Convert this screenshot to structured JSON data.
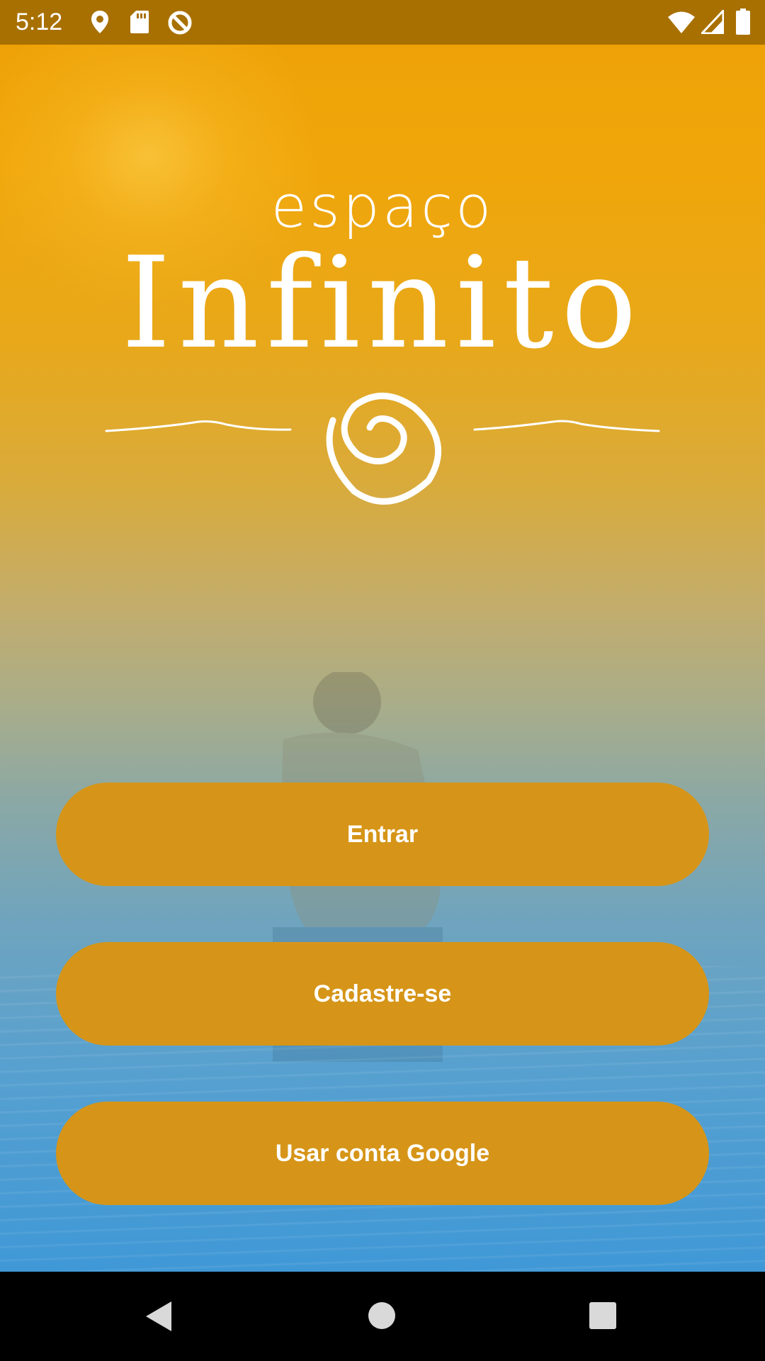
{
  "status_bar": {
    "time": "5:12",
    "left_icons": [
      "location-pin-icon",
      "sd-card-icon",
      "sync-blocked-icon"
    ],
    "right_icons": [
      "wifi-icon",
      "cell-signal-icon",
      "battery-icon"
    ]
  },
  "brand": {
    "small_word": "espaço",
    "big_word": "Infinito",
    "emblem": "spiral-icon"
  },
  "buttons": {
    "login_label": "Entrar",
    "signup_label": "Cadastre-se",
    "google_label": "Usar conta Google"
  },
  "nav_bar": {
    "icons": [
      "back-icon",
      "home-icon",
      "recents-icon"
    ]
  },
  "colors": {
    "status_bar": "#a87000",
    "button": "#d69518",
    "sky_top": "#eea207",
    "water_bottom": "#3f98d6"
  }
}
